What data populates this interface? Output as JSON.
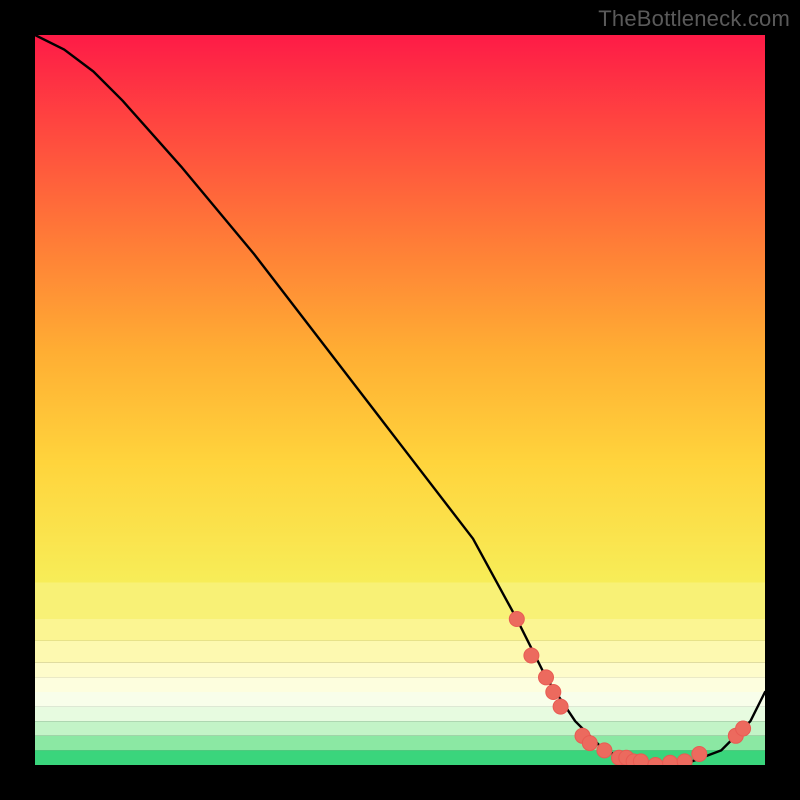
{
  "watermark": "TheBottleneck.com",
  "chart_data": {
    "type": "line",
    "title": "",
    "xlabel": "",
    "ylabel": "",
    "xlim": [
      0,
      100
    ],
    "ylim": [
      0,
      100
    ],
    "series": [
      {
        "name": "curve",
        "x": [
          0,
          4,
          8,
          12,
          20,
          30,
          40,
          50,
          60,
          66,
          70,
          74,
          78,
          82,
          86,
          90,
          94,
          98,
          100
        ],
        "y": [
          100,
          98,
          95,
          91,
          82,
          70,
          57,
          44,
          31,
          20,
          12,
          6,
          2,
          0.5,
          0,
          0.5,
          2,
          6,
          10
        ]
      }
    ],
    "markers": [
      {
        "x": 66,
        "y": 20
      },
      {
        "x": 68,
        "y": 15
      },
      {
        "x": 70,
        "y": 12
      },
      {
        "x": 71,
        "y": 10
      },
      {
        "x": 72,
        "y": 8
      },
      {
        "x": 75,
        "y": 4
      },
      {
        "x": 76,
        "y": 3
      },
      {
        "x": 78,
        "y": 2
      },
      {
        "x": 80,
        "y": 1
      },
      {
        "x": 81,
        "y": 1
      },
      {
        "x": 82,
        "y": 0.5
      },
      {
        "x": 83,
        "y": 0.5
      },
      {
        "x": 85,
        "y": 0
      },
      {
        "x": 87,
        "y": 0.3
      },
      {
        "x": 89,
        "y": 0.5
      },
      {
        "x": 91,
        "y": 1.5
      },
      {
        "x": 96,
        "y": 4
      },
      {
        "x": 97,
        "y": 5
      }
    ],
    "heat_bands": [
      {
        "y0": 100,
        "y1": 25,
        "type": "rainbow"
      },
      {
        "y0": 25,
        "y1": 20,
        "color": "#f8f176"
      },
      {
        "y0": 20,
        "y1": 17,
        "color": "#fbf592"
      },
      {
        "y0": 17,
        "y1": 14,
        "color": "#fdf9b0"
      },
      {
        "y0": 14,
        "y1": 12,
        "color": "#fefccb"
      },
      {
        "y0": 12,
        "y1": 10,
        "color": "#fdfede"
      },
      {
        "y0": 10,
        "y1": 8,
        "color": "#f8feea"
      },
      {
        "y0": 8,
        "y1": 6,
        "color": "#e7fbe0"
      },
      {
        "y0": 6,
        "y1": 4,
        "color": "#c3f4c7"
      },
      {
        "y0": 4,
        "y1": 2,
        "color": "#8be8a3"
      },
      {
        "y0": 2,
        "y1": 0,
        "color": "#3ad57c"
      }
    ]
  },
  "colors": {
    "marker_fill": "#ec6a5e",
    "marker_stroke": "#e85b53",
    "curve": "#000000"
  }
}
